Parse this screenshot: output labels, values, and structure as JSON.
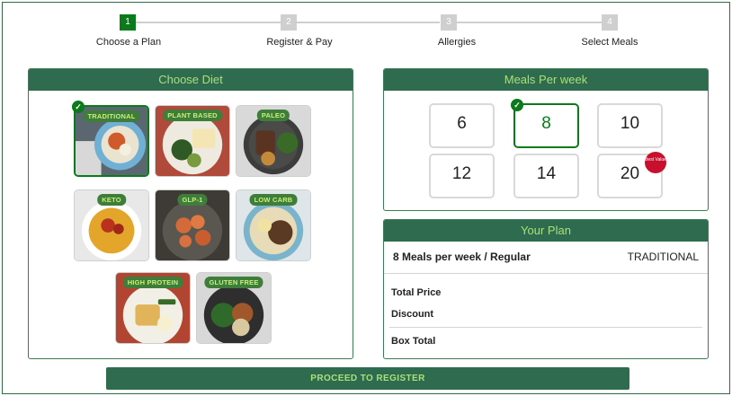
{
  "stepper": {
    "steps": [
      {
        "number": "1",
        "label": "Choose a Plan"
      },
      {
        "number": "2",
        "label": "Register & Pay"
      },
      {
        "number": "3",
        "label": "Allergies"
      },
      {
        "number": "4",
        "label": "Select Meals"
      }
    ],
    "active_step": 1
  },
  "diet_panel": {
    "title": "Choose Diet",
    "options": [
      {
        "label": "TRADITIONAL",
        "selected": true
      },
      {
        "label": "PLANT BASED",
        "selected": false
      },
      {
        "label": "PALEO",
        "selected": false
      },
      {
        "label": "KETO",
        "selected": false
      },
      {
        "label": "GLP-1",
        "selected": false
      },
      {
        "label": "LOW CARB",
        "selected": false
      },
      {
        "label": "HIGH PROTEIN",
        "selected": false
      },
      {
        "label": "GLUTEN FREE",
        "selected": false
      }
    ]
  },
  "meals_panel": {
    "title": "Meals Per week",
    "options": [
      "6",
      "8",
      "10",
      "12",
      "14",
      "20"
    ],
    "selected": "8",
    "badge_text": "Best Value"
  },
  "plan_panel": {
    "title": "Your Plan",
    "summary": "8 Meals per week / Regular",
    "diet": "TRADITIONAL",
    "total_price_label": "Total Price",
    "discount_label": "Discount",
    "box_total_label": "Box Total"
  },
  "proceed_label": "PROCEED TO REGISTER",
  "colors": {
    "accent_dark_green": "#2f6b4e",
    "selected_green": "#0a7a1a",
    "header_text": "#a8e07a",
    "badge_red": "#c8102e"
  }
}
